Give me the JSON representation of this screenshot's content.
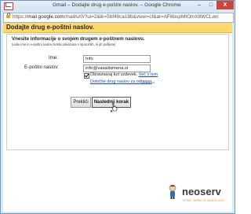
{
  "window": {
    "title": "Gmail – Dodajte drug e-poštni naslov. – Google Chrome",
    "minimize": "–",
    "maximize": "□",
    "close": "X"
  },
  "address_bar": {
    "url_prefix": "https://",
    "url_domain": "mail.google.com",
    "url_rest": "/mail/u/0/?ui=2&ik=5bf49ca18b&view=cf&at=AF6bupMIOmX8WCLwn"
  },
  "dialog": {
    "header": "Dodajte drug e-poštni naslov.",
    "intro": "Vnesite informacije o svojem drugem e-poštnem naslovu.",
    "intro_small": "(vaše ime in e-poštni naslov bosta prikazana v sporočilih, ki jih pošljete)",
    "name_label": "Ime:",
    "name_value": "Info",
    "email_label": "E-poštni naslov:",
    "email_value": "info@vasadomena.si",
    "alias_checkbox_checked": true,
    "alias_text": "Obravnavaj kot vzdevek.",
    "more_link": "Več o tem",
    "reply_to_link": "Določite drug naslov za odgovor",
    "reply_to_note": "(izbirno)",
    "cancel_button": "Prekliči",
    "next_button": "Naslednji korak »"
  },
  "brand": {
    "name": "neoserv",
    "tagline": "HITRO, VARNO IN ZANESLJIVO"
  }
}
